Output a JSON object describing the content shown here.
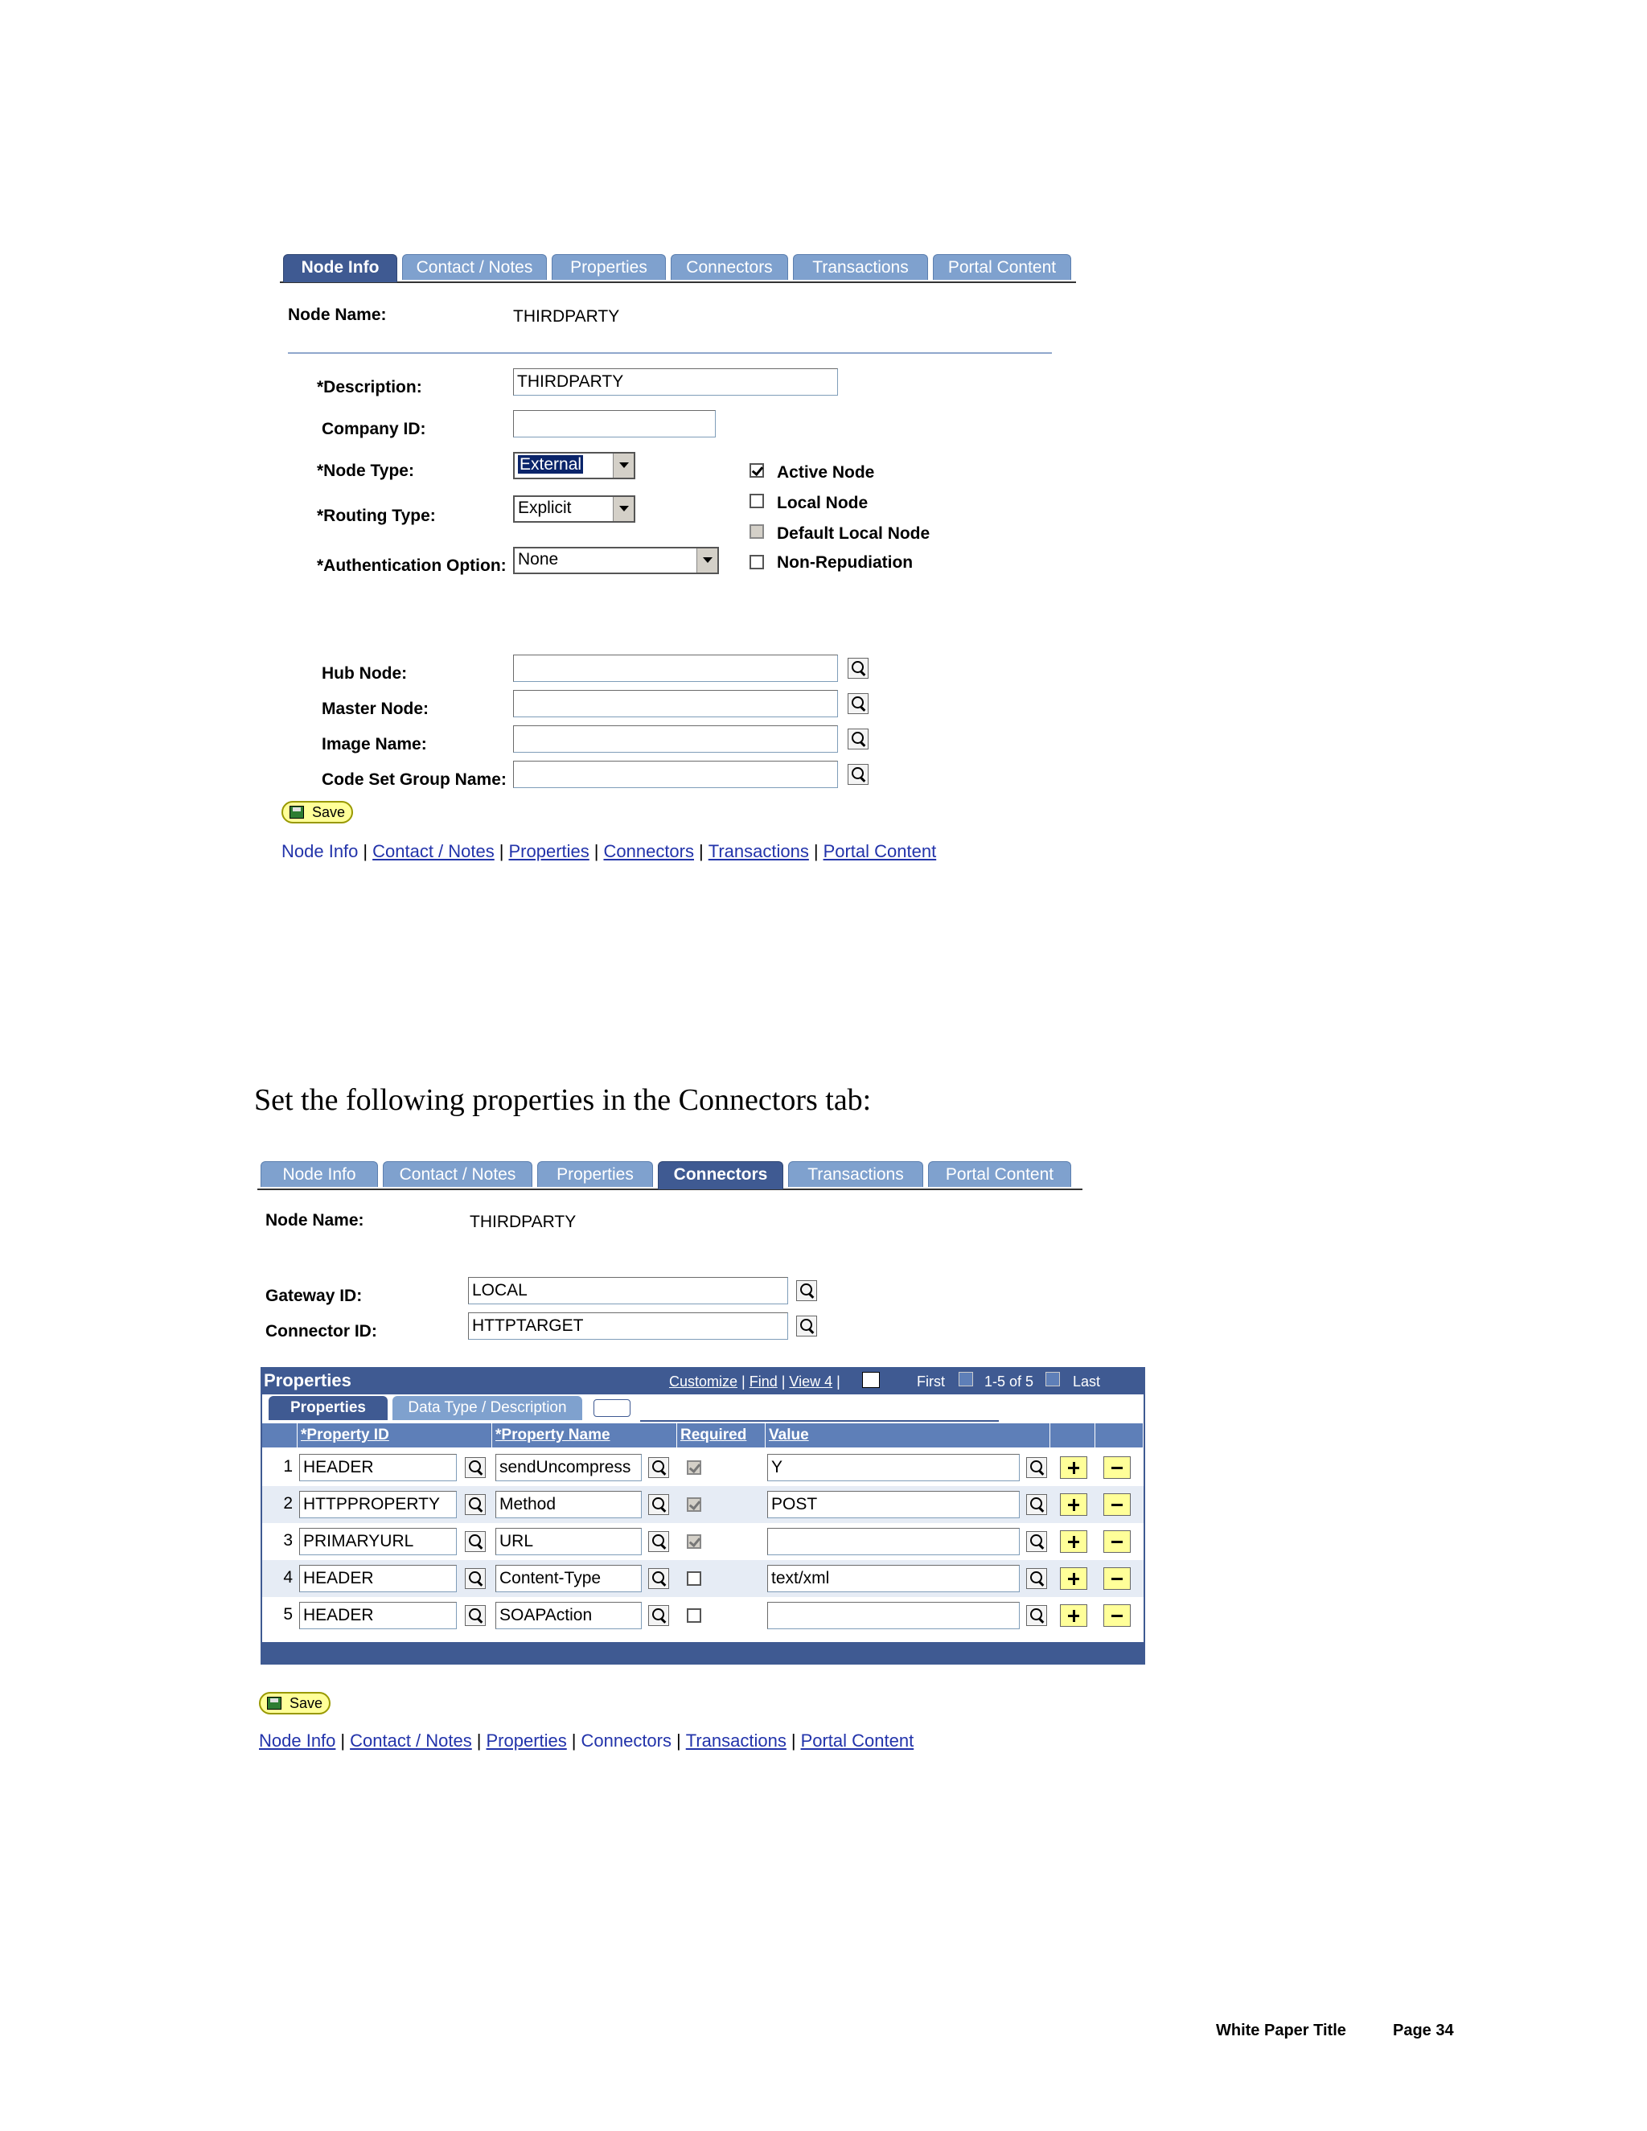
{
  "top_panel": {
    "tabs": [
      "Node Info",
      "Contact / Notes",
      "Properties",
      "Connectors",
      "Transactions",
      "Portal Content"
    ],
    "active_tab": "Node Info",
    "node_name_label": "Node Name:",
    "node_name_value": "THIRDPARTY",
    "description_label": "*Description:",
    "description_value": "THIRDPARTY",
    "company_id_label": "Company ID:",
    "company_id_value": "",
    "node_type_label": "*Node Type:",
    "node_type_value": "External",
    "routing_type_label": "*Routing Type:",
    "routing_type_value": "Explicit",
    "auth_option_label": "*Authentication Option:",
    "auth_option_value": "None",
    "checkboxes": [
      {
        "label": "Active Node",
        "checked": true,
        "disabled": false
      },
      {
        "label": "Local Node",
        "checked": false,
        "disabled": false
      },
      {
        "label": "Default Local Node",
        "checked": false,
        "disabled": true
      },
      {
        "label": "Non-Repudiation",
        "checked": false,
        "disabled": false
      }
    ],
    "hub_node_label": "Hub Node:",
    "master_node_label": "Master Node:",
    "image_name_label": "Image Name:",
    "code_set_label": "Code Set Group Name:",
    "save_label": "Save",
    "links": [
      "Node Info",
      "Contact / Notes",
      "Properties",
      "Connectors",
      "Transactions",
      "Portal Content"
    ]
  },
  "instruction_text": "Set the following properties in the Connectors tab:",
  "bottom_panel": {
    "tabs": [
      "Node Info",
      "Contact / Notes",
      "Properties",
      "Connectors",
      "Transactions",
      "Portal Content"
    ],
    "active_tab": "Connectors",
    "node_name_label": "Node Name:",
    "node_name_value": "THIRDPARTY",
    "gateway_label": "Gateway ID:",
    "gateway_value": "LOCAL",
    "connector_label": "Connector ID:",
    "connector_value": "HTTPTARGET",
    "grid": {
      "title": "Properties",
      "customize": "Customize",
      "find": "Find",
      "view": "View 4",
      "first": "First",
      "range": "1-5 of 5",
      "last": "Last",
      "subtab_active": "Properties",
      "subtab_inactive": "Data Type / Description",
      "headers": [
        "*Property ID",
        "*Property Name",
        "Required",
        "Value"
      ],
      "rows": [
        {
          "num": "1",
          "property_id": "HEADER",
          "property_name": "sendUncompress",
          "required": true,
          "value": "Y"
        },
        {
          "num": "2",
          "property_id": "HTTPPROPERTY",
          "property_name": "Method",
          "required": true,
          "value": "POST"
        },
        {
          "num": "3",
          "property_id": "PRIMARYURL",
          "property_name": "URL",
          "required": true,
          "value": ""
        },
        {
          "num": "4",
          "property_id": "HEADER",
          "property_name": "Content-Type",
          "required": false,
          "value": "text/xml"
        },
        {
          "num": "5",
          "property_id": "HEADER",
          "property_name": "SOAPAction",
          "required": false,
          "value": ""
        }
      ]
    },
    "save_label": "Save",
    "links": [
      "Node Info",
      "Contact / Notes",
      "Properties",
      "Connectors",
      "Transactions",
      "Portal Content"
    ]
  },
  "footer": {
    "title": "White Paper Title",
    "page": "Page 34"
  },
  "colors": {
    "tab_active": "#3F5A92",
    "tab_inactive": "#7FA1CE",
    "link": "#2233aa",
    "button_yellow": "#FFFF99"
  }
}
